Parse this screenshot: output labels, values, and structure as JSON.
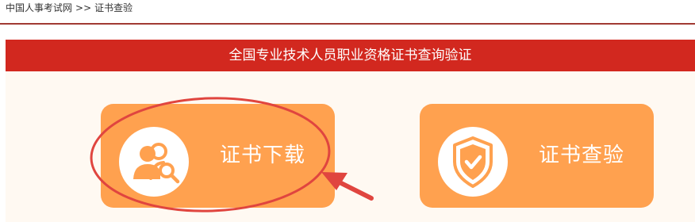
{
  "breadcrumb": {
    "home": "中国人事考试网",
    "separator": ">>",
    "current": "证书查验"
  },
  "panel": {
    "title": "全国专业技术人员职业资格证书查询验证"
  },
  "cards": {
    "download": {
      "label": "证书下载",
      "icon": "user-search-icon"
    },
    "verify": {
      "label": "证书查验",
      "icon": "shield-check-icon"
    }
  },
  "colors": {
    "header_red": "#d2281f",
    "card_orange": "#ffa14f",
    "panel_bg": "#fff9f2",
    "annotation_red": "#e0453f"
  }
}
